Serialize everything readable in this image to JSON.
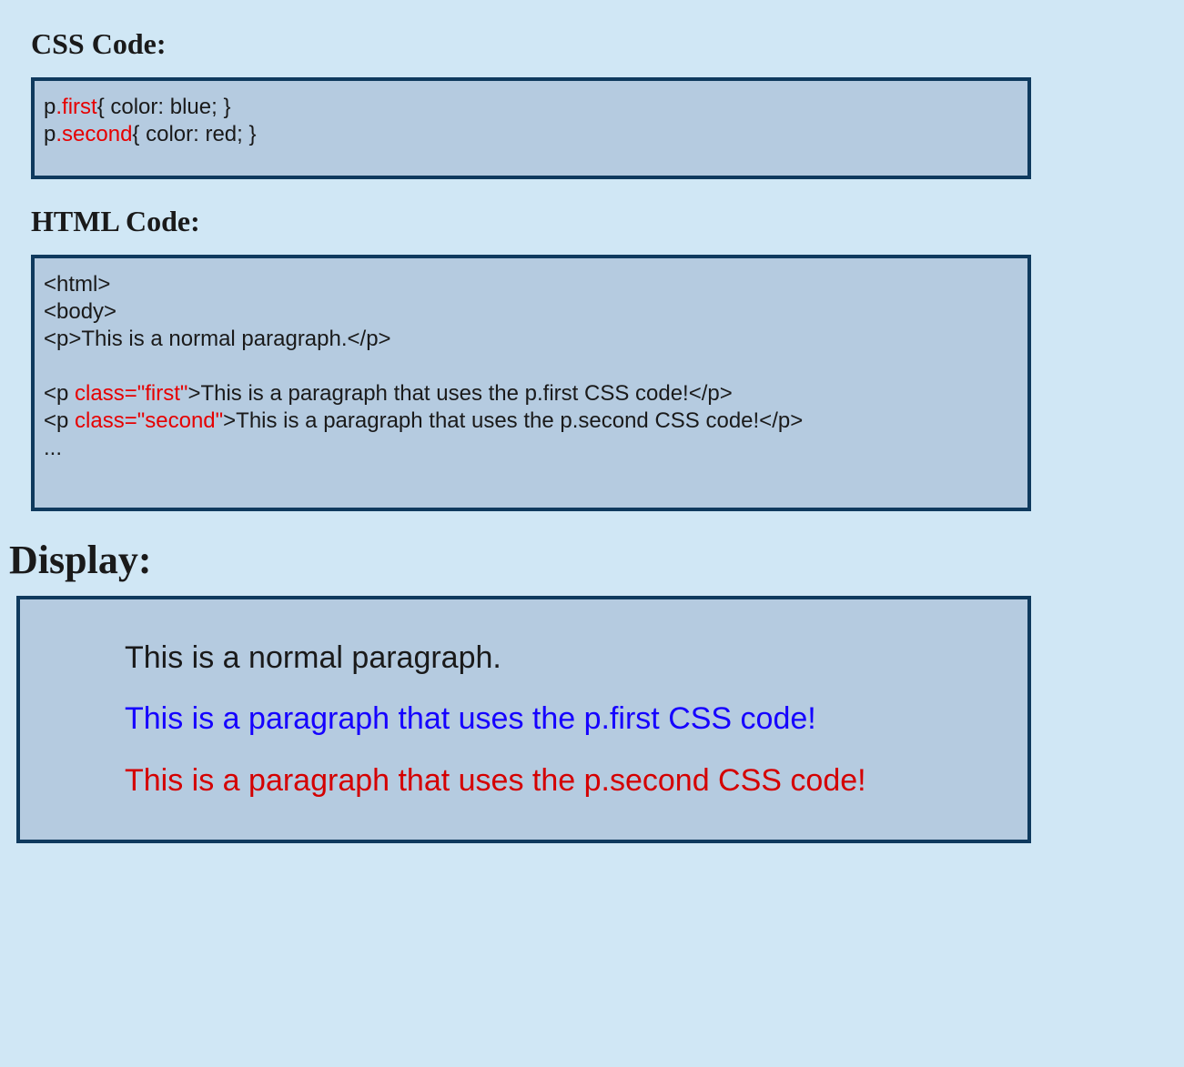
{
  "cssHeading": "CSS Code:",
  "htmlHeading": "HTML Code:",
  "displayHeading": "Display:",
  "cssCode": {
    "line1": {
      "prefix": "p",
      "selector": ".first",
      "rule": "{ color: blue; }"
    },
    "line2": {
      "prefix": "p",
      "selector": ".second",
      "rule": "{ color: red; }"
    }
  },
  "htmlCode": {
    "line1": "<html>",
    "line2": "<body>",
    "line3": "<p>This is a normal paragraph.</p>",
    "line4_prefix": "<p ",
    "line4_attr": "class=\"first\"",
    "line4_suffix": ">This is a paragraph that uses the p.first CSS code!</p>",
    "line5_prefix": "<p ",
    "line5_attr": "class=\"second\"",
    "line5_suffix": ">This is a paragraph that uses the p.second CSS code!</p>",
    "line6": "..."
  },
  "display": {
    "p1": "This is a normal paragraph.",
    "p2": "This is a paragraph that uses the p.first CSS code!",
    "p3": "This is a paragraph that uses the p.second CSS code!"
  }
}
